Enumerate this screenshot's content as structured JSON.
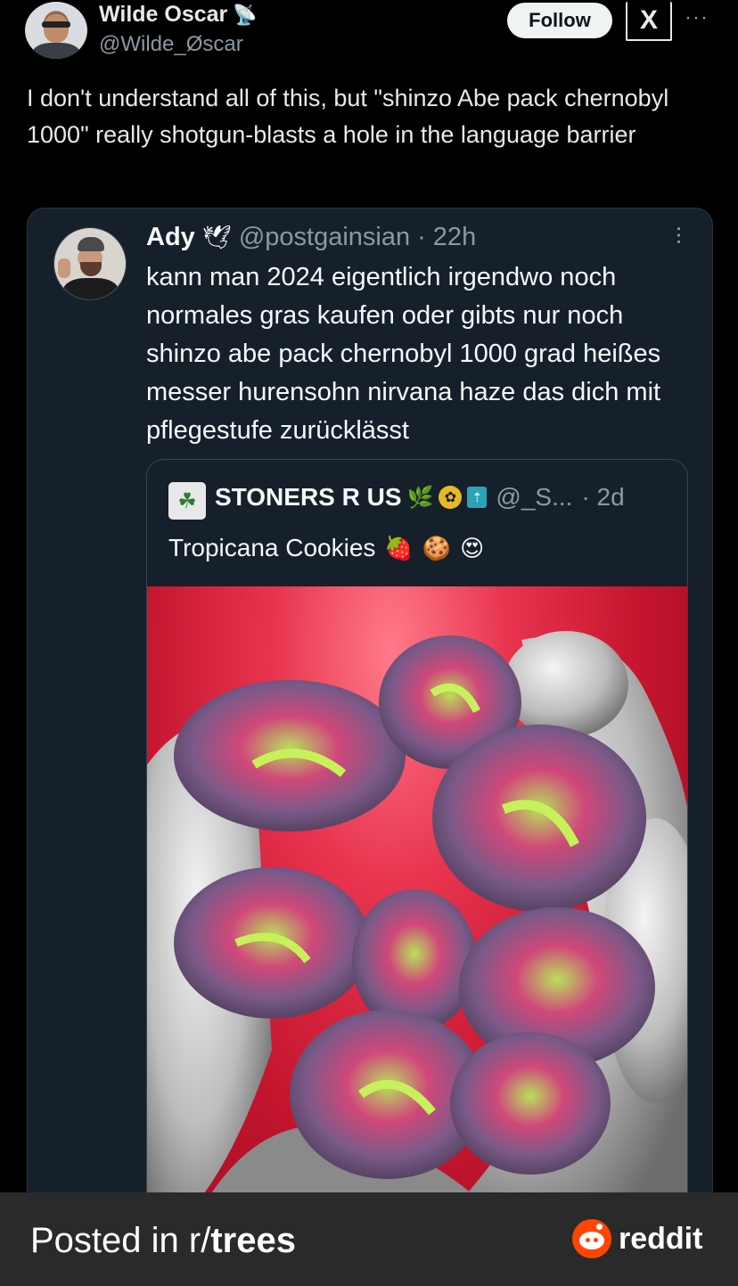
{
  "author": {
    "name": "Wilde Oscar",
    "handle": "@Wilde_Øscar",
    "badge_icon": "satellite-dish-icon",
    "follow_label": "Follow",
    "x_logo_text": "X",
    "more_label": "···"
  },
  "tweet_text": "I don't understand all of this,  but \"shinzo Abe pack chernobyl 1000\" really shotgun-blasts a hole in the language barrier",
  "quoted": {
    "name": "Ady",
    "name_emoji": "🕊",
    "handle": "@postgainsian",
    "time": "· 22h",
    "more_label": "···",
    "text": "kann man 2024 eigentlich irgendwo noch normales gras kaufen oder gibts nur noch shinzo abe pack chernobyl 1000 grad heißes messer hurensohn nirvana haze das dich mit pflegestufe zurücklässt",
    "inner": {
      "name": "STONERS R US",
      "leaf_emoji": "🌿",
      "verified_badge": "✿",
      "square_badge": "⇡",
      "handle": "@_S...",
      "time": "· 2d",
      "text": "Tropicana Cookies",
      "emojis": [
        "🍓",
        "🍪",
        "😍"
      ]
    }
  },
  "footer": {
    "posted_prefix": "Posted in r/",
    "subreddit": "trees",
    "brand": "reddit"
  },
  "colors": {
    "background": "#000000",
    "card": "#15202b",
    "accent_reddit": "#ff4500",
    "muted_text": "#8b98a5"
  }
}
